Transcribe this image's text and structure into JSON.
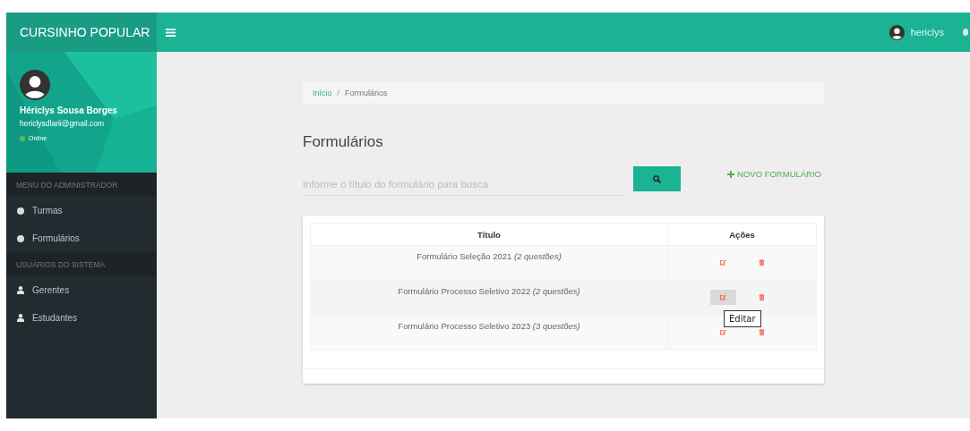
{
  "brand": "CURSINHO POPULAR",
  "topbar": {
    "user": "hericlys"
  },
  "profile": {
    "name": "Hériclys Sousa Borges",
    "email": "hericlysdlarii@gmail.com",
    "status": "Online",
    "online": true
  },
  "sidebar": {
    "sections": [
      {
        "title": "MENU DO ADMINISTRADOR",
        "items": [
          {
            "label": "Turmas",
            "kind": "dot",
            "selected": false
          },
          {
            "label": "Formulários",
            "kind": "dot",
            "selected": false
          }
        ]
      },
      {
        "title": "USUÁRIOS DO SISTEMA",
        "items": [
          {
            "label": "Gerentes",
            "kind": "user",
            "selected": false
          },
          {
            "label": "Estudantes",
            "kind": "user",
            "selected": false
          }
        ]
      }
    ]
  },
  "breadcrumb_separator": "/",
  "breadcrumb": [
    {
      "label": "Início",
      "link": true
    },
    {
      "label": "Formulários",
      "link": false
    }
  ],
  "page_title": "Formulários",
  "search": {
    "placeholder": "Informe o título do formulário para busca"
  },
  "new_button": "NOVO FORMULÁRIO",
  "table": {
    "columns": [
      "Título",
      "Ações"
    ],
    "rows": [
      {
        "title": "Formulário Seleção 2021 *(2 questões)*",
        "edit_hovered": false
      },
      {
        "title": "Formulário Processo Seletivo 2022 *(2 questões)*",
        "edit_hovered": true,
        "tooltip": "Editar"
      },
      {
        "title": "Formulário Processo Seletivo 2023 *(3 questões)*",
        "edit_hovered": false
      }
    ]
  }
}
